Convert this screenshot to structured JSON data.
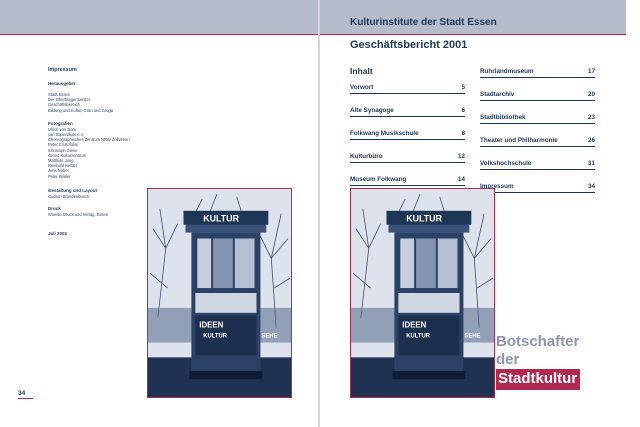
{
  "left_page": {
    "imprint": {
      "title": "Impressum",
      "publisher_heading": "Herausgeber",
      "publisher_lines": [
        "Stadt Essen",
        "Der Oberbürgermeister",
        "Geschäftsbereich",
        "Bildung und Kultur, Grün und Gruga"
      ],
      "photographers_heading": "Fotografien",
      "photographers_lines": [
        "Ulrich von Born",
        "carl Stipendium e.V.",
        "Choreographisches Zentrum NRW Zollverein",
        "Peter Cristofolini",
        "Christoph Giese",
        "Grend Kulturzentrum",
        "Matthias Jung",
        "Reinhold Kettler",
        "Jens Nober",
        "Peter Wieler"
      ],
      "design_heading": "Gestaltung und Layout",
      "design_lines": [
        "Gudrun Brandenbusch"
      ],
      "print_heading": "Druck",
      "print_lines": [
        "Woeste Druck und Verlag, Essen"
      ],
      "date": "Juli 2002"
    },
    "page_number": "34"
  },
  "right_page": {
    "institution_title": "Kulturinstitute der Stadt Essen",
    "report_title": "Geschäftsbericht 2001",
    "toc_heading": "Inhalt",
    "toc_left": [
      {
        "label": "Vorwort",
        "page": "5"
      },
      {
        "label": "Alte Synagoge",
        "page": "6"
      },
      {
        "label": "Folkwang Musikschule",
        "page": "8"
      },
      {
        "label": "Kulturbüro",
        "page": "12"
      },
      {
        "label": "Museum Folkwang",
        "page": "14"
      }
    ],
    "toc_right": [
      {
        "label": "Ruhrlandmuseum",
        "page": "17"
      },
      {
        "label": "Stadtarchiv",
        "page": "20"
      },
      {
        "label": "Stadtbibliothek",
        "page": "23"
      },
      {
        "label": "Theater und Philharmonie",
        "page": "26"
      },
      {
        "label": "Volkshochschule",
        "page": "31"
      },
      {
        "label": "Impressum",
        "page": "34"
      }
    ],
    "slogan": {
      "line1": "Botschafter",
      "line2": "der",
      "line3": "Stadtkultur"
    }
  },
  "photo": {
    "sign_text": "KULTUR",
    "poster_texts": [
      "IDEEN",
      "KULTUR",
      "SEHE"
    ]
  },
  "colors": {
    "navy": "#1e3656",
    "accent": "#b2294e",
    "band": "#b6bccb",
    "slogan_grey": "#8c95ad"
  }
}
